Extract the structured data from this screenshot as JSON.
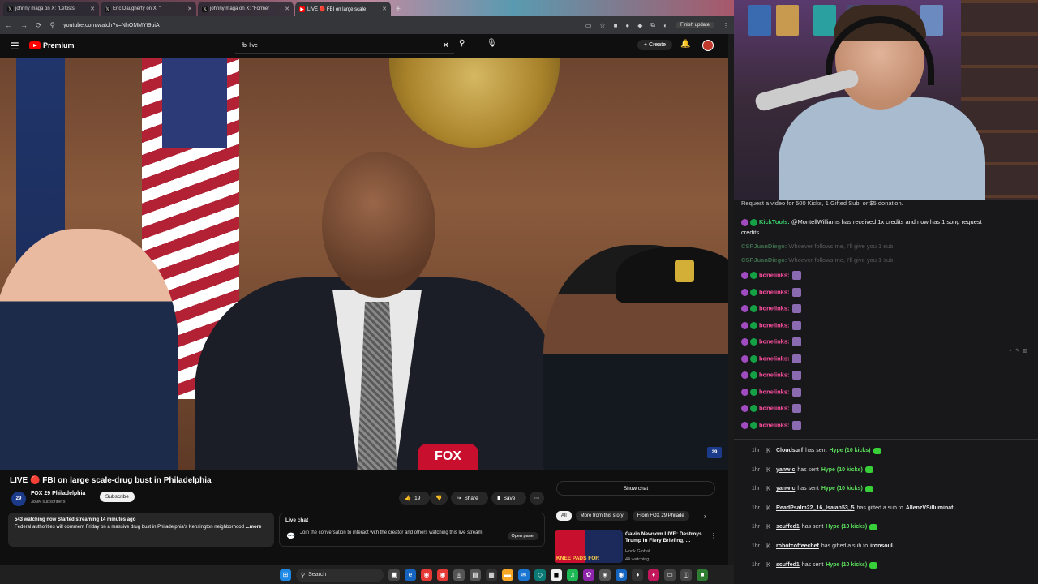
{
  "browser": {
    "tabs": [
      {
        "label": "johnny maga on X: \"Leftists",
        "favicon": "x-icon",
        "active": false
      },
      {
        "label": "Eric Daugherty on X: \"",
        "favicon": "x-icon",
        "active": false
      },
      {
        "label": "johnny maga on X: \"Former",
        "favicon": "x-icon",
        "active": false
      },
      {
        "label": "LIVE 🔴 FBI on large scale",
        "favicon": "youtube-icon",
        "active": true
      }
    ],
    "url": "youtube.com/watch?v=NhOMMYt9uiA",
    "finish_update": "Finish update"
  },
  "youtube": {
    "logo": "Premium",
    "search_value": "fbi live",
    "create_label": "Create",
    "video_title": "LIVE 🔴 FBI on large scale-drug bust in Philadelphia",
    "overlay_text": "FOX",
    "overlay_badge": "29",
    "channel": {
      "name": "FOX 29 Philadelphia",
      "subscribers": "389K subscribers",
      "avatar": "29"
    },
    "subscribe_label": "Subscribe",
    "likes": "19",
    "share_label": "Share",
    "save_label": "Save",
    "description": {
      "meta": "543 watching now  Started streaming 14 minutes ago",
      "text": "Federal authorities will comment Friday on a massive drug bust in Philadelphia's Kensington neighborhood",
      "more": "...more"
    },
    "livechat": {
      "heading": "Live chat",
      "body": "Join the conversation to interact with the creator and others watching this live stream.",
      "open_panel": "Open panel"
    },
    "show_chat": "Show chat",
    "chips": [
      "All",
      "More from this story",
      "From FOX 29 Philade"
    ],
    "recommendation": {
      "title": "Gavin Newsom LIVE: Destroys Trump In Fiery Briefing, ...",
      "channel": "Hook Global",
      "watching": "44 watching",
      "thumb_caption": "KNEE PADS FOR"
    }
  },
  "chat": {
    "top_line": "Request a video for 500 Kicks, 1 Gifted Sub, or $5 donation.",
    "kicktools": {
      "name": "KickTools:",
      "text": "@MontellWilliams has received 1x credits and now has 1 song request",
      "text2": "credits."
    },
    "faded": [
      {
        "name": "CSPJuanDiego:",
        "text": "Whoever follows me, I'll give you 1 sub."
      },
      {
        "name": "CSPJuanDiego:",
        "text": "Whoever follows me, I'll give you 1 sub."
      }
    ],
    "repeat_name": "bonelinks:",
    "repeat_count": 10
  },
  "events": [
    {
      "time": "1hr",
      "user": "Cloudsurf",
      "action": "has sent",
      "amount": "Hype (10 kicks)",
      "kick": true
    },
    {
      "time": "1hr",
      "user": "yanwic",
      "action": "has sent",
      "amount": "Hype (10 kicks)",
      "kick": true
    },
    {
      "time": "1hr",
      "user": "yanwic",
      "action": "has sent",
      "amount": "Hype (10 kicks)",
      "kick": true
    },
    {
      "time": "1hr",
      "user": "ReadPsalm22_16_Isaiah53_5",
      "action": "has gifted a sub to",
      "amount": "AllenzVSilluminati.",
      "kick": false
    },
    {
      "time": "1hr",
      "user": "scuffed1",
      "action": "has sent",
      "amount": "Hype (10 kicks)",
      "kick": true
    },
    {
      "time": "1hr",
      "user": "robotcoffeechef",
      "action": "has gifted a sub to",
      "amount": "ironsoul.",
      "kick": false
    },
    {
      "time": "1hr",
      "user": "scuffed1",
      "action": "has sent",
      "amount": "Hype (10 kicks)",
      "kick": true
    }
  ],
  "taskbar": {
    "search_label": "Search"
  },
  "colors": {
    "yt_red": "#ff0000",
    "chat_green": "#14a044",
    "kick_green": "#38d038",
    "bonelinks": "#ff4fa0"
  }
}
